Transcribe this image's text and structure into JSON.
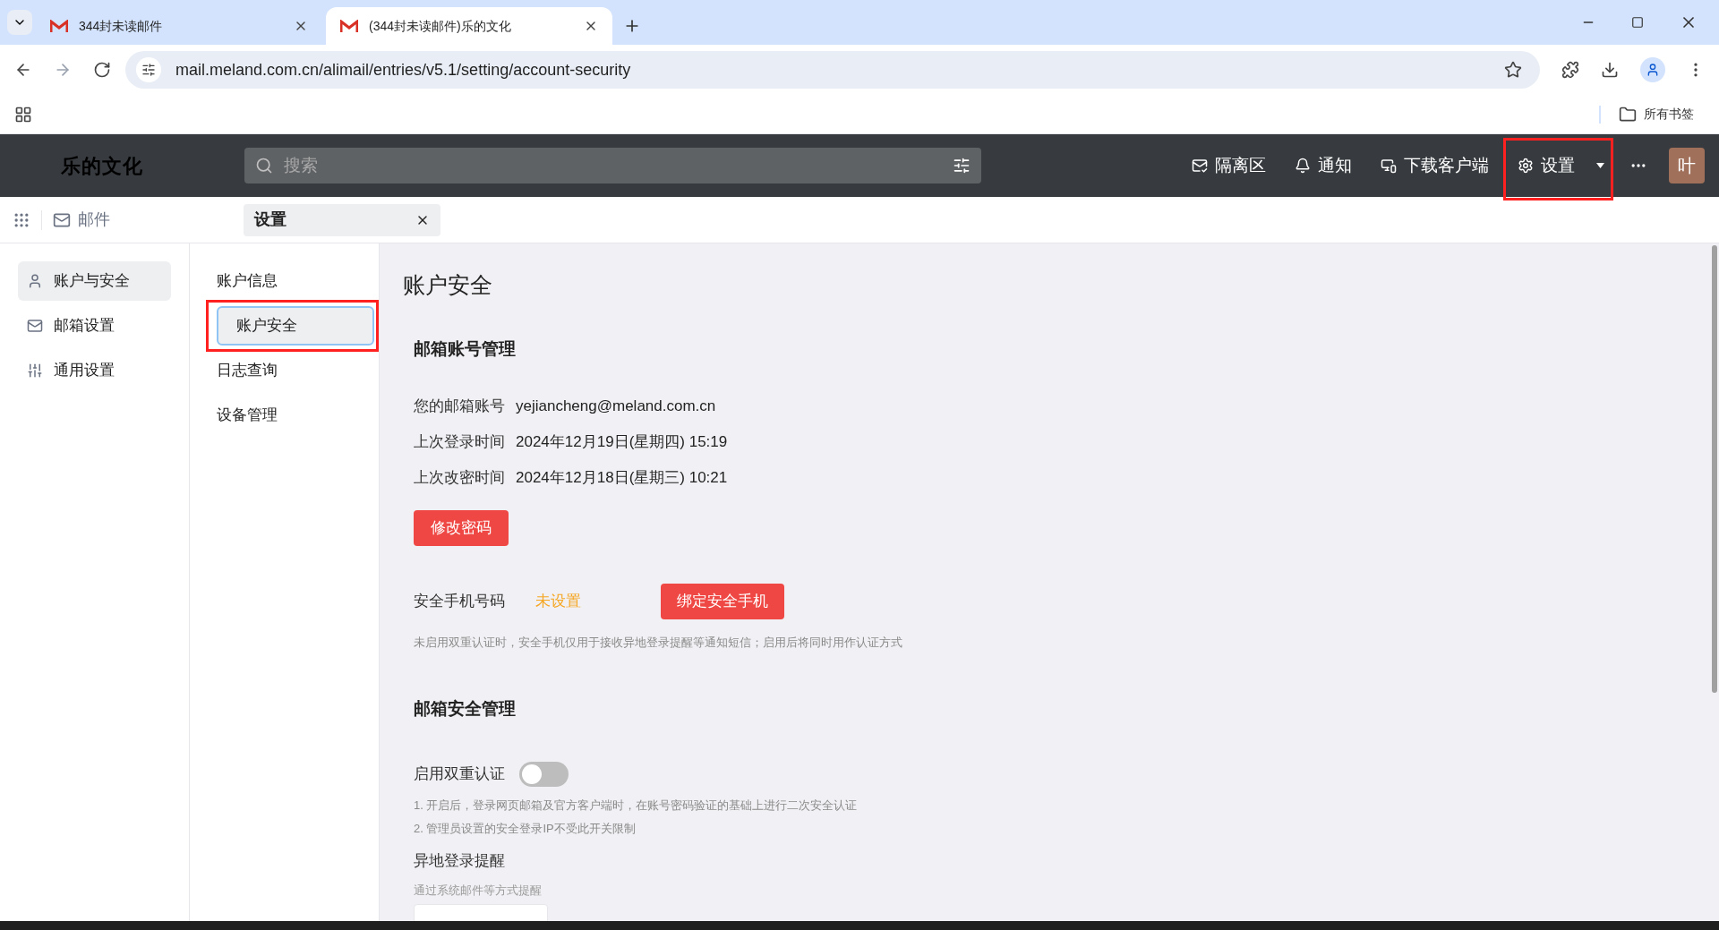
{
  "browser": {
    "tabs": [
      {
        "title": "344封未读邮件",
        "selected": false
      },
      {
        "title": "(344封未读邮件)乐的文化",
        "selected": true
      }
    ],
    "url": "mail.meland.com.cn/alimail/entries/v5.1/setting/account-security",
    "bookmarks_label": "所有书签"
  },
  "header": {
    "logo": "乐的文化",
    "search": {
      "placeholder": "搜索"
    },
    "actions": [
      {
        "kind": "quarantine",
        "label": "隔离区",
        "annotated": false
      },
      {
        "kind": "bell",
        "label": "通知",
        "annotated": false
      },
      {
        "kind": "devices",
        "label": "下载客户端",
        "annotated": false
      },
      {
        "kind": "gear",
        "label": "设置",
        "annotated": true
      }
    ],
    "avatar": "叶"
  },
  "subheader": {
    "app_label": "邮件",
    "tab": {
      "label": "设置"
    }
  },
  "sidebar": {
    "items": [
      {
        "kind": "user",
        "label": "账户与安全",
        "selected": true
      },
      {
        "kind": "mail",
        "label": "邮箱设置",
        "selected": false
      },
      {
        "kind": "sliders",
        "label": "通用设置",
        "selected": false
      }
    ]
  },
  "submenu": {
    "items": [
      {
        "label": "账户信息",
        "selected": false,
        "annotated": false
      },
      {
        "label": "账户安全",
        "selected": true,
        "annotated": true
      },
      {
        "label": "日志查询",
        "selected": false,
        "annotated": false
      },
      {
        "label": "设备管理",
        "selected": false,
        "annotated": false
      }
    ]
  },
  "content": {
    "title": "账户安全",
    "account_section": {
      "heading": "邮箱账号管理",
      "rows": [
        {
          "label": "您的邮箱账号",
          "value": "yejiancheng@meland.com.cn"
        },
        {
          "label": "上次登录时间",
          "value": "2024年12月19日(星期四) 15:19"
        },
        {
          "label": "上次改密时间",
          "value": "2024年12月18日(星期三) 10:21"
        }
      ],
      "button": "修改密码"
    },
    "phone": {
      "label": "安全手机号码",
      "status": "未设置",
      "button": "绑定安全手机",
      "note": "未启用双重认证时，安全手机仅用于接收异地登录提醒等通知短信；启用后将同时用作认证方式"
    },
    "security_section": {
      "heading": "邮箱安全管理",
      "two_factor": {
        "label": "启用双重认证",
        "on": false,
        "notes": [
          "1. 开启后，登录网页邮箱及官方客户端时，在账号密码验证的基础上进行二次安全认证",
          "2. 管理员设置的安全登录IP不受此开关限制"
        ]
      },
      "remote_login": {
        "label": "异地登录提醒",
        "hint": "通过系统邮件等方式提醒"
      }
    }
  }
}
